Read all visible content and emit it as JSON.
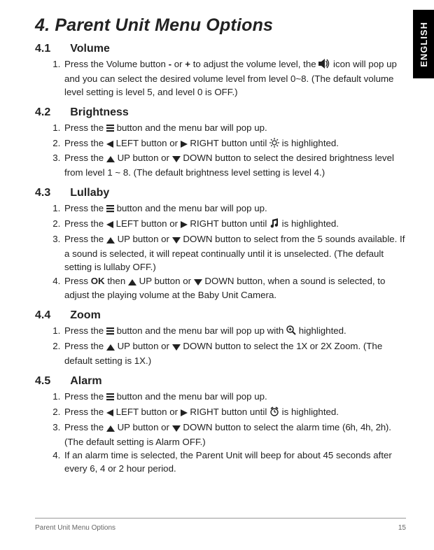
{
  "language_tab": "ENGLISH",
  "title": "4. Parent Unit Menu Options",
  "sections": {
    "s1": {
      "num": "4.1",
      "label": "Volume"
    },
    "s2": {
      "num": "4.2",
      "label": "Brightness"
    },
    "s3": {
      "num": "4.3",
      "label": "Lullaby"
    },
    "s4": {
      "num": "4.4",
      "label": "Zoom"
    },
    "s5": {
      "num": "4.5",
      "label": "Alarm"
    }
  },
  "t": {
    "s1_1a": "Press the Volume button ",
    "minus": "-",
    "s1_1b": " or ",
    "plus": "+",
    "s1_1c": " to adjust the volume level, the ",
    "s1_1d": " icon will pop up and you can select the desired volume level from level 0~8. (The default volume level setting is level 5, and level 0 is OFF.)",
    "s2_1a": "Press the ",
    "s2_1b": " button and the menu bar will pop up.",
    "s2_2a": "Press the ",
    "s2_2b": " LEFT button or ",
    "s2_2c": " RIGHT button until ",
    "s2_2d": " is highlighted.",
    "s2_3a": "Press the ",
    "s2_3b": " UP button or ",
    "s2_3c": " DOWN button to select the desired brightness level from level 1 ~ 8. (The default brightness level setting is level 4.)",
    "s3_1a": "Press the ",
    "s3_1b": " button and the menu bar will pop up.",
    "s3_2a": "Press the ",
    "s3_2b": " LEFT button or ",
    "s3_2c": " RIGHT button until ",
    "s3_2d": " is highlighted.",
    "s3_3a": "Press the ",
    "s3_3b": " UP button or ",
    "s3_3c": " DOWN button to select from the 5 sounds available. If a sound is selected, it will repeat continually until it is unselected. (The default setting is lullaby OFF.)",
    "s3_4a": "Press ",
    "ok": "OK",
    "s3_4b": " then ",
    "s3_4c": " UP button or ",
    "s3_4d": " DOWN button, when a sound is selected, to adjust the playing volume at the Baby Unit Camera.",
    "s4_1a": "Press the ",
    "s4_1b": " button and the menu bar will pop up with ",
    "s4_1c": " highlighted.",
    "s4_2a": "Press the ",
    "s4_2b": " UP button or ",
    "s4_2c": " DOWN button to select the ",
    "onex": "1X",
    "s4_2d": " or ",
    "twox": "2X",
    "s4_2e": " Zoom. (The default setting is 1X.)",
    "s5_1a": "Press the ",
    "s5_1b": " button and the menu bar will pop up.",
    "s5_2a": "Press the ",
    "s5_2b": " LEFT button or ",
    "s5_2c": " RIGHT button until ",
    "s5_2d": " is highlighted.",
    "s5_3a": "Press the ",
    "s5_3b": " UP button or ",
    "s5_3c": " DOWN button to select the alarm time (",
    "sixH": "6h",
    "comma1": ", ",
    "fourH": "4h",
    "comma2": ", ",
    "twoH": "2h",
    "s5_3d": "). (The default setting is Alarm OFF.)",
    "s5_4": "If an alarm time is selected, the Parent Unit will beep for about 45 seconds after every 6, 4 or 2 hour period."
  },
  "footer": {
    "left": "Parent Unit Menu Options",
    "right": "15"
  }
}
